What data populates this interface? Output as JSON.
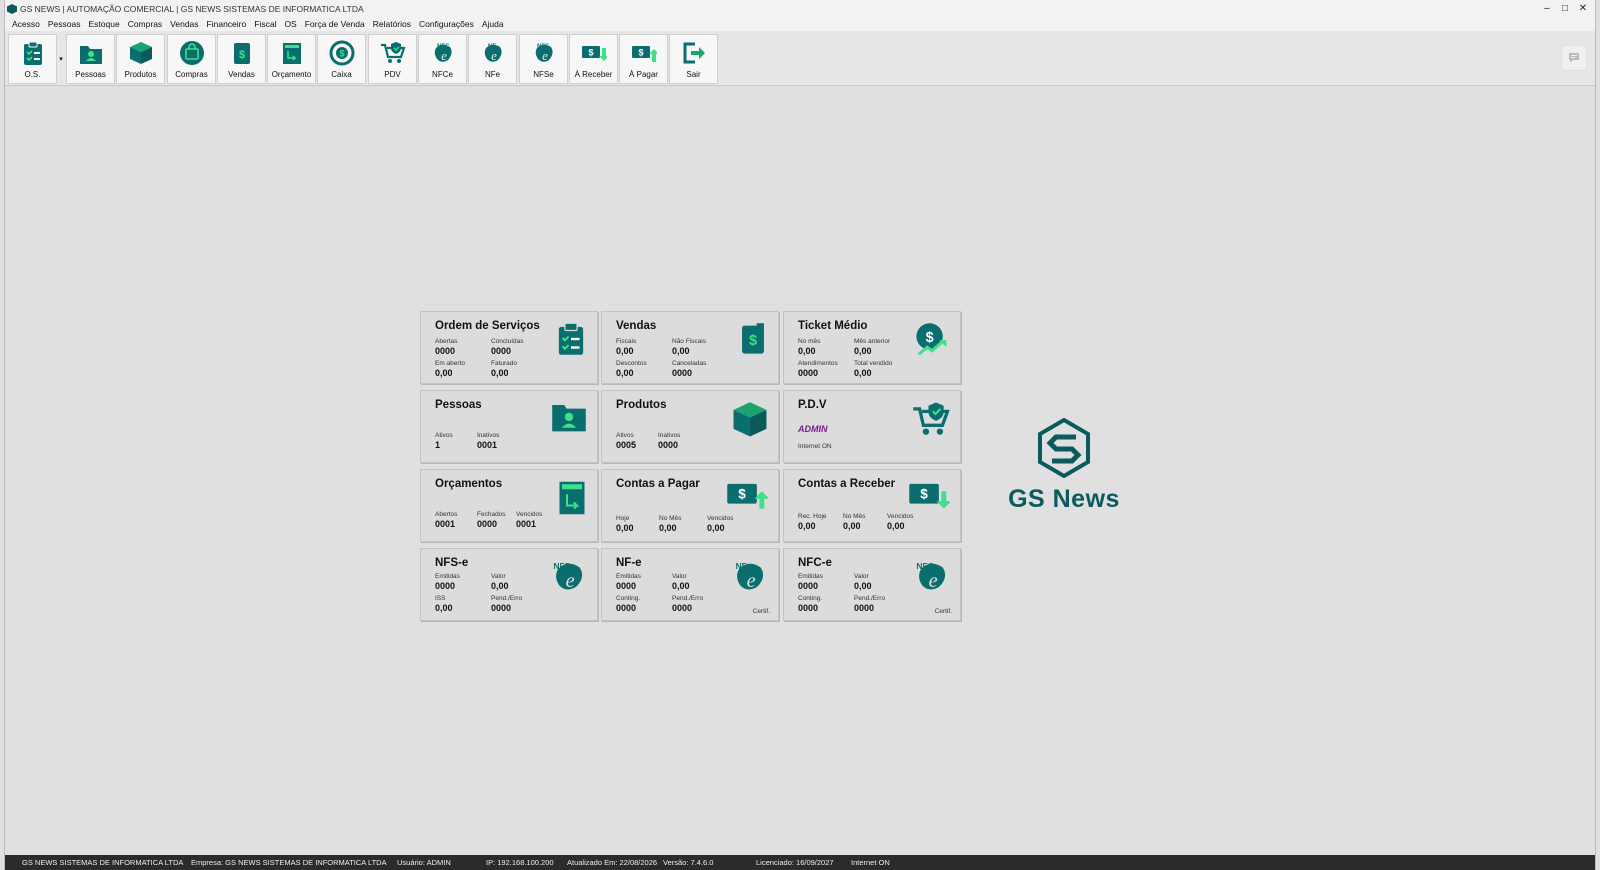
{
  "window": {
    "title": "GS NEWS | AUTOMAÇÃO COMERCIAL | GS NEWS SISTEMAS DE INFORMATICA LTDA",
    "controls": {
      "minimize": "–",
      "maximize": "□",
      "close": "✕"
    }
  },
  "menu": [
    "Acesso",
    "Pessoas",
    "Estoque",
    "Compras",
    "Vendas",
    "Financeiro",
    "Fiscal",
    "OS",
    "Força de Venda",
    "Relatórios",
    "Configurações",
    "Ajuda"
  ],
  "toolbar": {
    "os": "O.S.",
    "dropdown": "▾",
    "pessoas": "Pessoas",
    "produtos": "Produtos",
    "compras": "Compras",
    "vendas": "Vendas",
    "orcamento": "Orçamento",
    "caixa": "Caixa",
    "pdv": "PDV",
    "nfce": "NFCe",
    "nfe": "NFe",
    "nfse": "NFSe",
    "receber": "À Receber",
    "pagar": "À Pagar",
    "sair": "Sair"
  },
  "cards": {
    "os": {
      "title": "Ordem de Serviços",
      "abertas_l": "Abertas",
      "abertas": "0000",
      "concluidas_l": "Concluídas",
      "concluidas": "0000",
      "emaberto_l": "Em aberto",
      "emaberto": "0,00",
      "faturado_l": "Faturado",
      "faturado": "0,00"
    },
    "vendas": {
      "title": "Vendas",
      "fiscais_l": "Fiscais",
      "fiscais": "0,00",
      "naofiscais_l": "Não Fiscais",
      "naofiscais": "0,00",
      "descontos_l": "Descontos",
      "descontos": "0,00",
      "canceladas_l": "Canceladas",
      "canceladas": "0000"
    },
    "ticket": {
      "title": "Ticket Médio",
      "nomes_l": "No mês",
      "nomes": "0,00",
      "mesant_l": "Mês anterior",
      "mesant": "0,00",
      "atend_l": "Atendimentos",
      "atend": "0000",
      "total_l": "Total vendido",
      "total": "0,00"
    },
    "pessoas": {
      "title": "Pessoas",
      "ativos_l": "Ativos",
      "ativos": "1",
      "inativos_l": "Inativos",
      "inativos": "0001"
    },
    "produtos": {
      "title": "Produtos",
      "ativos_l": "Ativos",
      "ativos": "0005",
      "inativos_l": "Inativos",
      "inativos": "0000"
    },
    "pdv": {
      "title": "P.D.V",
      "user": "ADMIN",
      "internet": "Internet ON"
    },
    "orcamentos": {
      "title": "Orçamentos",
      "abertos_l": "Abertos",
      "abertos": "0001",
      "fechados_l": "Fechados",
      "fechados": "0000",
      "vencidos_l": "Vencidos",
      "vencidos": "0001"
    },
    "pagar": {
      "title": "Contas a Pagar",
      "hoje_l": "Hoje",
      "hoje": "0,00",
      "nomes_l": "No Mês",
      "nomes": "0,00",
      "vencidos_l": "Vencidos",
      "vencidos": "0,00"
    },
    "receber": {
      "title": "Contas a Receber",
      "hoje_l": "Rec. Hoje",
      "hoje": "0,00",
      "nomes_l": "No Mês",
      "nomes": "0,00",
      "vencidos_l": "Vencidos",
      "vencidos": "0,00"
    },
    "nfse": {
      "title": "NFS-e",
      "emitidas_l": "Emitidas",
      "emitidas": "0000",
      "valor_l": "Valor",
      "valor": "0,00",
      "iss_l": "ISS",
      "iss": "0,00",
      "pend_l": "Pend./Erro",
      "pend": "0000"
    },
    "nfe": {
      "title": "NF-e",
      "emitidas_l": "Emitidas",
      "emitidas": "0000",
      "valor_l": "Valor",
      "valor": "0,00",
      "conting_l": "Conting.",
      "conting": "0000",
      "pend_l": "Pend./Erro",
      "pend": "0000",
      "certif": "Certif."
    },
    "nfce": {
      "title": "NFC-e",
      "emitidas_l": "Emitidas",
      "emitidas": "0000",
      "valor_l": "Valor",
      "valor": "0,00",
      "conting_l": "Conting.",
      "conting": "0000",
      "pend_l": "Pend./Erro",
      "pend": "0000",
      "certif": "Certif."
    }
  },
  "logo": {
    "text": "GS News"
  },
  "status": {
    "company": "GS NEWS SISTEMAS DE INFORMATICA LTDA",
    "empresa": "Empresa: GS NEWS SISTEMAS DE INFORMATICA LTDA",
    "usuario": "Usuário: ADMIN",
    "ip": "IP: 192.168.100.200",
    "atualizado": "Atualizado Em: 22/08/2026",
    "versao": "Versão: 7.4.6.0",
    "licenciado": "Licenciado: 16/09/2027",
    "internet": "Internet ON"
  },
  "colors": {
    "accent": "#0b6e6e",
    "accent_light": "#1aa36f",
    "admin": "#7a1b8c",
    "status_bg": "#2b2b2b"
  }
}
